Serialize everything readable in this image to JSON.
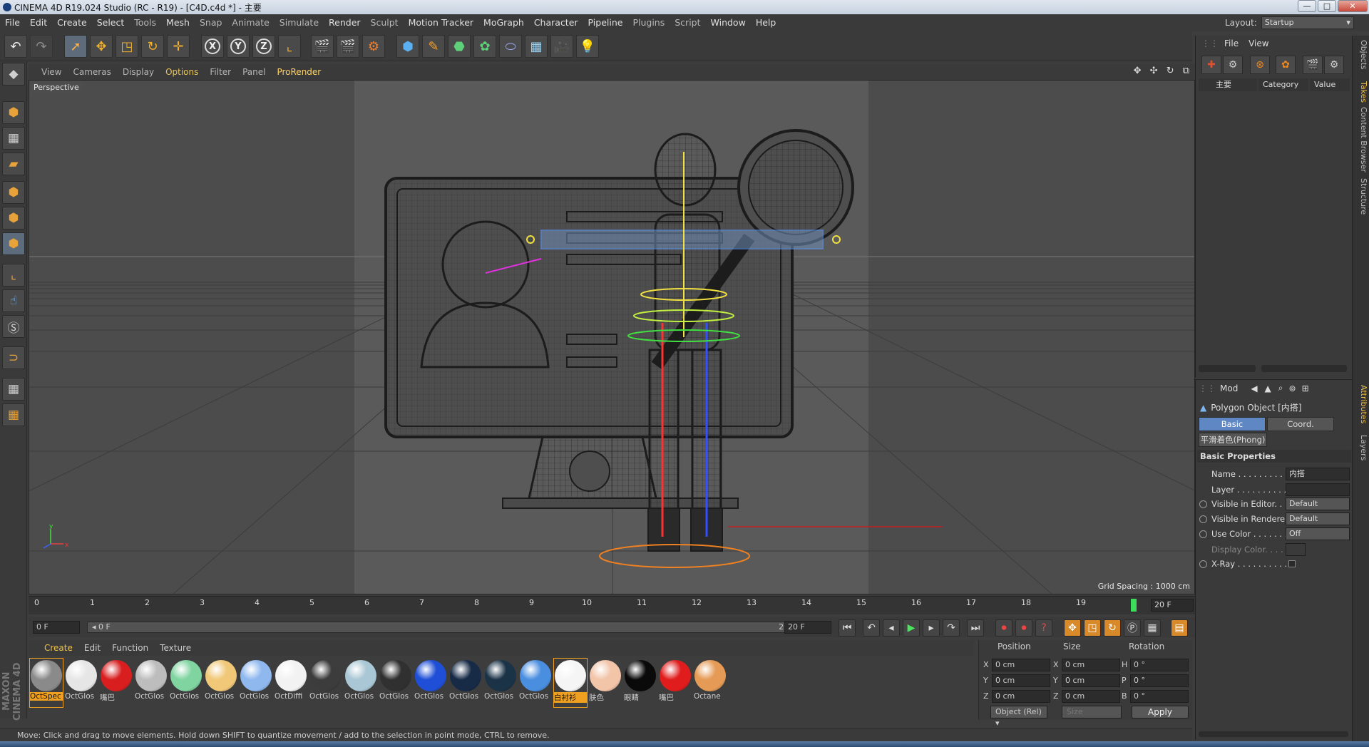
{
  "window": {
    "title": "CINEMA 4D R19.024 Studio (RC - R19) - [C4D.c4d *] - 主要",
    "buttons": {
      "minimize": "—",
      "maximize": "□",
      "close": "✕"
    }
  },
  "menu": [
    "File",
    "Edit",
    "Create",
    "Select",
    "Tools",
    "Mesh",
    "Snap",
    "Animate",
    "Simulate",
    "Render",
    "Sculpt",
    "Motion Tracker",
    "MoGraph",
    "Character",
    "Pipeline",
    "Plugins",
    "Script",
    "Window",
    "Help"
  ],
  "layout": {
    "label": "Layout:",
    "value": "Startup"
  },
  "viewport": {
    "menu": [
      "View",
      "Cameras",
      "Display",
      "Options",
      "Filter",
      "Panel",
      "ProRender"
    ],
    "nav_icons": "✥ ✣ ↻ ⧉",
    "camera_label": "Perspective",
    "grid_spacing": "Grid Spacing : 1000 cm"
  },
  "timeline": {
    "ticks": [
      "0",
      "1",
      "2",
      "3",
      "4",
      "5",
      "6",
      "7",
      "8",
      "9",
      "10",
      "11",
      "12",
      "13",
      "14",
      "15",
      "16",
      "17",
      "18",
      "19"
    ],
    "current_frame_field": "20 F"
  },
  "transport": {
    "start_field": "0 F",
    "range_left": "◂ 0 F",
    "range_right": "20 F ▸",
    "end_field": "20 F"
  },
  "materials": {
    "menu": [
      "Create",
      "Edit",
      "Function",
      "Texture"
    ],
    "items": [
      {
        "label": "OctSpec",
        "color": "#8a8a8a",
        "selected": true
      },
      {
        "label": "OctGlos",
        "color": "#e6e6e6"
      },
      {
        "label": "嘴巴",
        "color": "#d81e1e"
      },
      {
        "label": "OctGlos",
        "color": "#bdbdbd"
      },
      {
        "label": "OctGlos",
        "color": "#7fd4a0"
      },
      {
        "label": "OctGlos",
        "color": "#f0c878"
      },
      {
        "label": "OctGlos",
        "color": "#8fb8ef"
      },
      {
        "label": "OctDiffi",
        "color": "#f2f2f2"
      },
      {
        "label": "OctGlos",
        "color": "#3c3c3c"
      },
      {
        "label": "OctGlos",
        "color": "#a9c7d4"
      },
      {
        "label": "OctGlos",
        "color": "#303030"
      },
      {
        "label": "OctGlos",
        "color": "#1e4fd6"
      },
      {
        "label": "OctGlos",
        "color": "#172a46"
      },
      {
        "label": "OctGlos",
        "color": "#1b3347"
      },
      {
        "label": "OctGlos",
        "color": "#4a8ee0"
      },
      {
        "label": "白衬衫",
        "color": "#f5f5f5",
        "selected": true
      },
      {
        "label": "肤色",
        "color": "#f2c4a8"
      },
      {
        "label": "眼睛",
        "color": "#0a0a0a"
      },
      {
        "label": "嘴巴",
        "color": "#e01c1c"
      },
      {
        "label": "Octane",
        "color": "#e59a55"
      }
    ]
  },
  "coordinates": {
    "headers": [
      "Position",
      "Size",
      "Rotation"
    ],
    "rows": [
      {
        "axis": "X",
        "pos": "0 cm",
        "size_axis": "X",
        "size": "0 cm",
        "rot_axis": "H",
        "rot": "0 °"
      },
      {
        "axis": "Y",
        "pos": "0 cm",
        "size_axis": "Y",
        "size": "0 cm",
        "rot_axis": "P",
        "rot": "0 °"
      },
      {
        "axis": "Z",
        "pos": "0 cm",
        "size_axis": "Z",
        "size": "0 cm",
        "rot_axis": "B",
        "rot": "0 °"
      }
    ],
    "mode": "Object (Rel) ▾",
    "size_mode": "Size",
    "apply": "Apply"
  },
  "status": "Move: Click and drag to move elements. Hold down SHIFT to quantize movement / add to the selection in point mode, CTRL to remove.",
  "takes_panel": {
    "menu": [
      "File",
      "View"
    ],
    "columns": {
      "name": "主要",
      "category": "Category",
      "value": "Value"
    }
  },
  "attributes": {
    "mode_label": "Mod",
    "object_title": "Polygon Object [内搭]",
    "tabs": [
      "Basic",
      "Coord."
    ],
    "subtab": "平滑着色(Phong)",
    "section": "Basic Properties",
    "props": [
      {
        "label": "Name . . . . . . . . . . .",
        "value": "内搭"
      },
      {
        "label": "Layer  . . . . . . . . . . .",
        "value": ""
      },
      {
        "label": "Visible in Editor. . .",
        "value": "Default"
      },
      {
        "label": "Visible in Renderer",
        "value": "Default"
      },
      {
        "label": "Use Color . . . . . . . .",
        "value": "Off"
      },
      {
        "label": "Display Color. . . . . ▸",
        "value": ""
      },
      {
        "label": "X-Ray . . . . . . . . . .",
        "value": ""
      }
    ]
  },
  "side_tabs": [
    "Objects",
    "Takes",
    "Content Browser",
    "Structure",
    "Attributes",
    "Layers"
  ],
  "branding": "MAXON CINEMA 4D"
}
